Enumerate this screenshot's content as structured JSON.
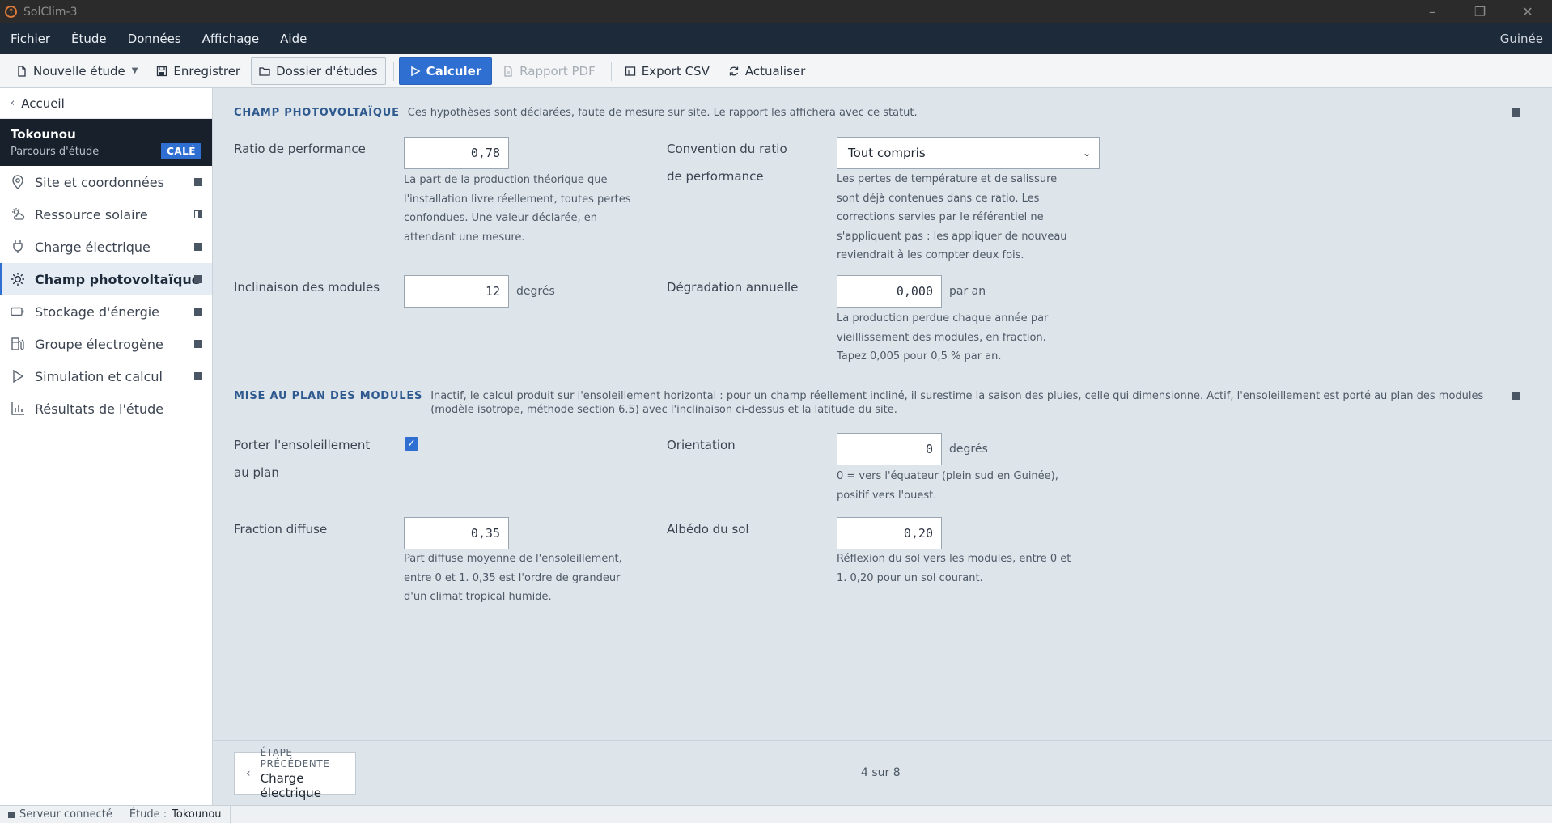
{
  "window": {
    "title": "SolClim-3",
    "minimize": "–",
    "restore": "❐",
    "close": "✕"
  },
  "menu": {
    "items": [
      "Fichier",
      "Étude",
      "Données",
      "Affichage",
      "Aide"
    ],
    "region": "Guinée"
  },
  "toolbar": {
    "new_study": "Nouvelle étude",
    "save": "Enregistrer",
    "folder": "Dossier d'études",
    "compute": "Calculer",
    "pdf": "Rapport PDF",
    "csv": "Export CSV",
    "refresh": "Actualiser"
  },
  "sidebar": {
    "back": "Accueil",
    "project": {
      "name": "Tokounou",
      "subtitle": "Parcours d'étude",
      "badge": "CALÉ"
    },
    "items": [
      {
        "label": "Site et coordonnées",
        "icon": "location-pin-icon",
        "status": "complete"
      },
      {
        "label": "Ressource solaire",
        "icon": "sun-cloud-icon",
        "status": "partial"
      },
      {
        "label": "Charge électrique",
        "icon": "plug-icon",
        "status": "complete"
      },
      {
        "label": "Champ photovoltaïque",
        "icon": "sun-icon",
        "status": "complete",
        "active": true
      },
      {
        "label": "Stockage d'énergie",
        "icon": "battery-icon",
        "status": "complete"
      },
      {
        "label": "Groupe électrogène",
        "icon": "fuel-pump-icon",
        "status": "complete"
      },
      {
        "label": "Simulation et calcul",
        "icon": "play-icon",
        "status": "complete"
      },
      {
        "label": "Résultats de l'étude",
        "icon": "bar-chart-icon",
        "status": "none"
      }
    ]
  },
  "section1": {
    "title": "CHAMP PHOTOVOLTAÏQUE",
    "desc": "Ces hypothèses sont déclarées, faute de mesure sur site. Le rapport les affichera avec ce statut.",
    "pr_label": "Ratio de performance",
    "pr_value": "0,78",
    "pr_help": "La part de la production théorique que l'installation livre réellement, toutes pertes confondues. Une valeur déclarée, en attendant une mesure.",
    "conv_label": "Convention du ratio de performance",
    "conv_value": "Tout compris",
    "conv_help": "Les pertes de température et de salissure sont déjà contenues dans ce ratio. Les corrections servies par le référentiel ne s'appliquent pas : les appliquer de nouveau reviendrait à les compter deux fois.",
    "tilt_label": "Inclinaison des modules",
    "tilt_value": "12",
    "tilt_unit": "degrés",
    "deg_label": "Dégradation annuelle",
    "deg_value": "0,000",
    "deg_unit": "par an",
    "deg_help": "La production perdue chaque année par vieillissement des modules, en fraction. Tapez 0,005 pour 0,5 % par an."
  },
  "section2": {
    "title": "MISE AU PLAN DES MODULES",
    "desc": "Inactif, le calcul produit sur l'ensoleillement horizontal : pour un champ réellement incliné, il surestime la saison des pluies, celle qui dimensionne. Actif, l'ensoleillement est porté au plan des modules (modèle isotrope, méthode section 6.5) avec l'inclinaison ci-dessus et la latitude du site.",
    "poa_label": "Porter l'ensoleillement au plan",
    "poa_checked": true,
    "orient_label": "Orientation",
    "orient_value": "0",
    "orient_unit": "degrés",
    "orient_help": "0 = vers l'équateur (plein sud en Guinée), positif vers l'ouest.",
    "diffuse_label": "Fraction diffuse",
    "diffuse_value": "0,35",
    "diffuse_help": "Part diffuse moyenne de l'ensoleillement, entre 0 et 1. 0,35 est l'ordre de grandeur d'un climat tropical humide.",
    "albedo_label": "Albédo du sol",
    "albedo_value": "0,20",
    "albedo_help": "Réflexion du sol vers les modules, entre 0 et 1. 0,20 pour un sol courant."
  },
  "footer": {
    "prev_small": "ÉTAPE PRÉCÉDENTE",
    "prev_label": "Charge électrique",
    "step": "4 sur 8"
  },
  "status": {
    "server": "Serveur connecté",
    "study_label": "Étude :",
    "study_name": "Tokounou"
  }
}
